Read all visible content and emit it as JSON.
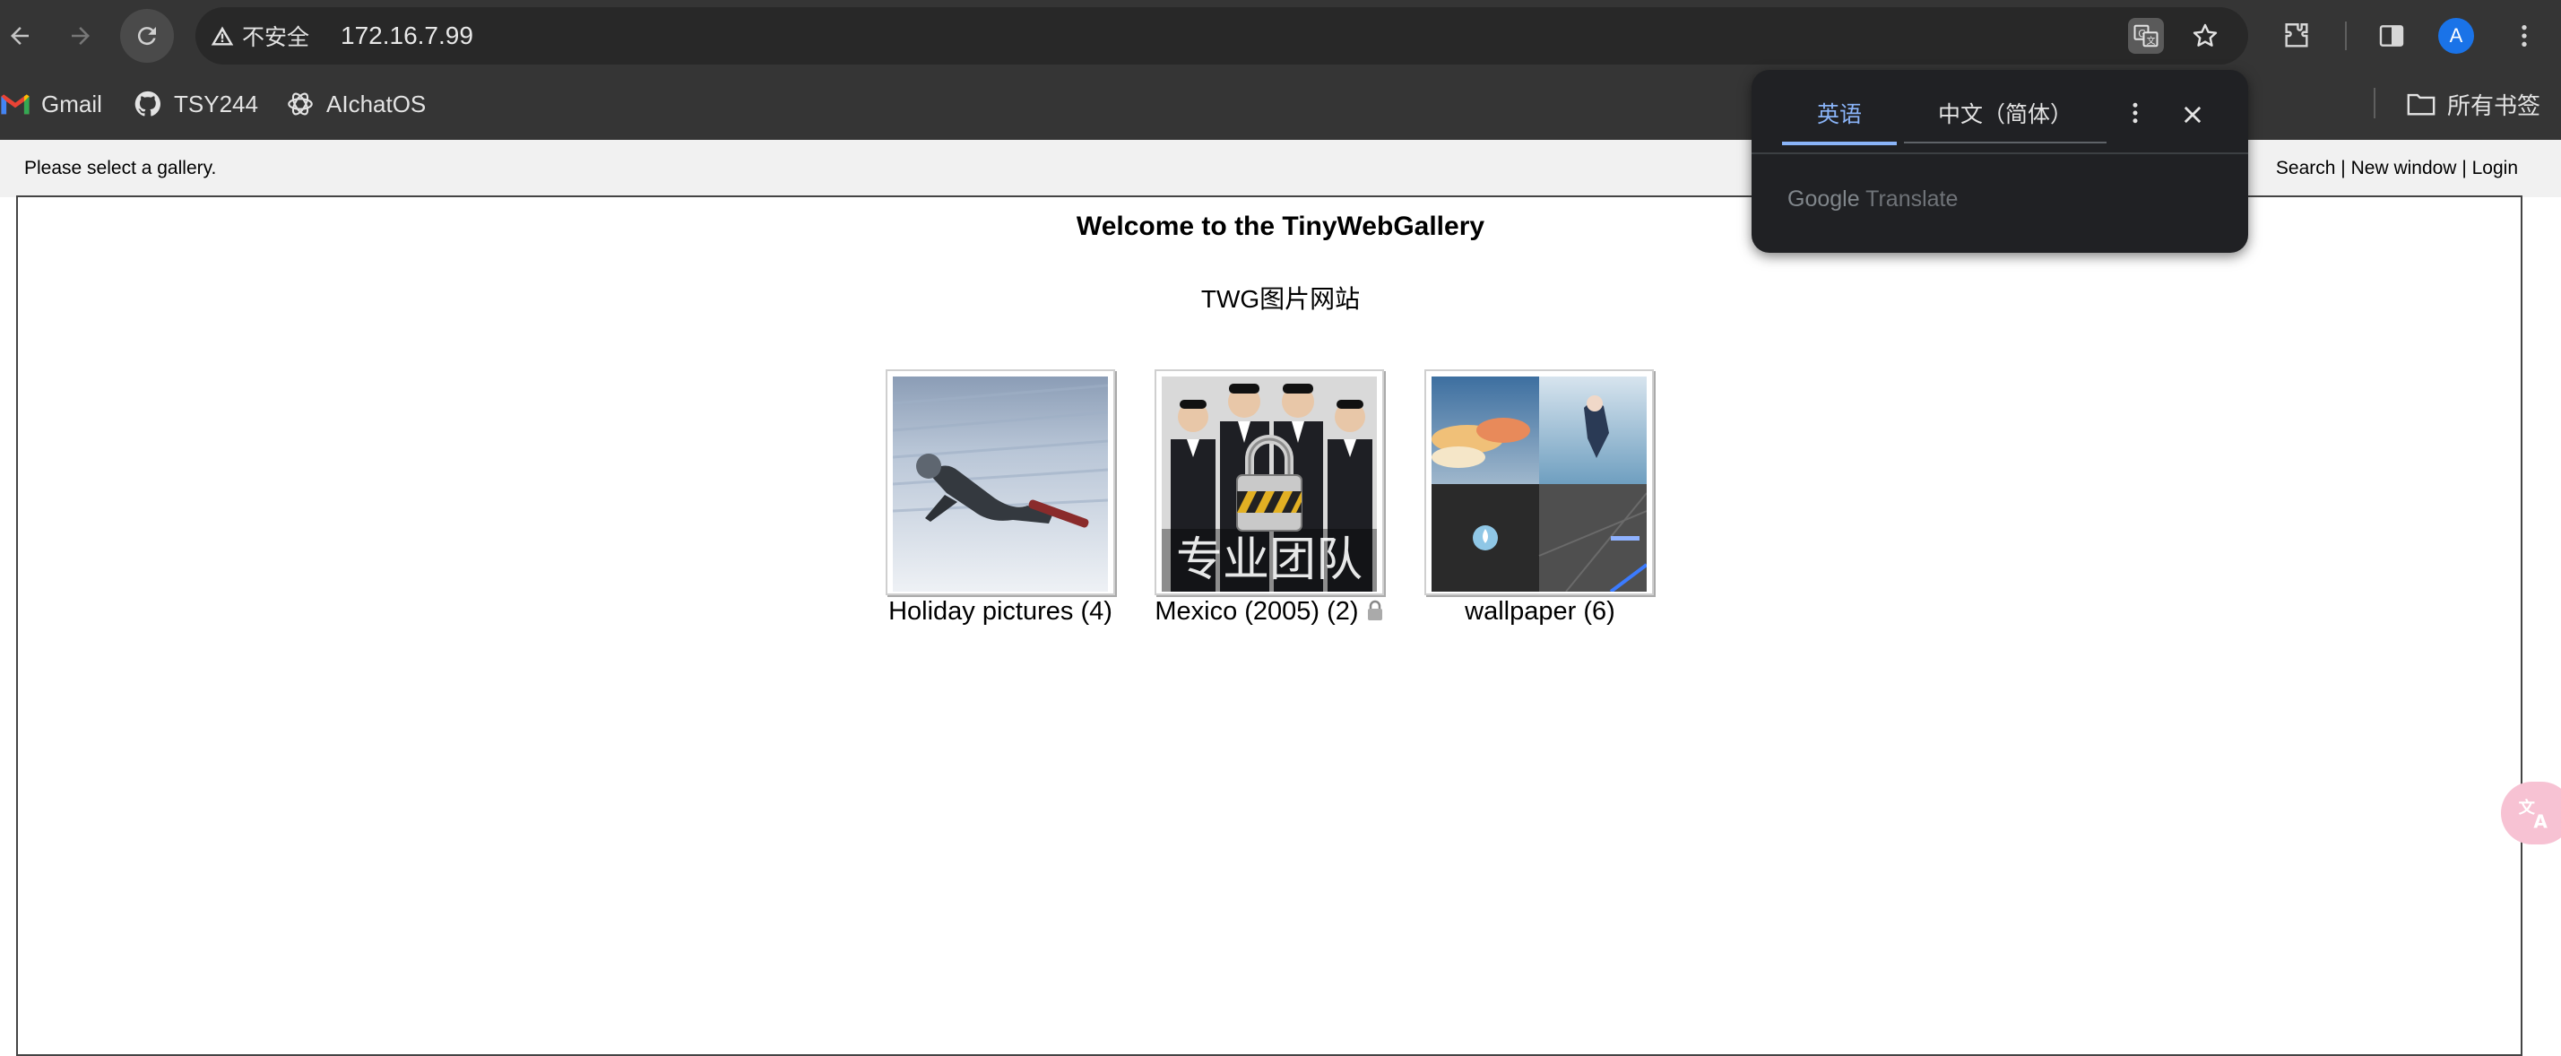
{
  "browser": {
    "security_label": "不安全",
    "url": "172.16.7.99",
    "avatar_letter": "A",
    "all_bookmarks_label": "所有书签"
  },
  "bookmarks": [
    {
      "label": "Gmail",
      "icon": "gmail-icon"
    },
    {
      "label": "TSY244",
      "icon": "github-icon"
    },
    {
      "label": "AIchatOS",
      "icon": "openai-icon"
    }
  ],
  "page": {
    "select_message": "Please select a gallery.",
    "top_links": [
      "Search",
      "New window",
      "Login"
    ],
    "link_separator": " | ",
    "welcome": "Welcome to the TinyWebGallery",
    "subtitle": "TWG图片网站",
    "galleries": [
      {
        "label": "Holiday pictures (4)",
        "locked": false
      },
      {
        "label": "Mexico (2005) (2)",
        "locked": true,
        "overlay_text": "专业团队"
      },
      {
        "label": "wallpaper (6)",
        "locked": false
      }
    ]
  },
  "translate_popup": {
    "source_tab": "英语",
    "target_tab": "中文（简体）",
    "brand_google": "Google",
    "brand_translate": "Translate"
  },
  "colors": {
    "chrome_bg": "#353535",
    "omnibox_bg": "#282828",
    "popup_bg": "#202124",
    "accent_blue": "#8ab4f8",
    "avatar_blue": "#1a73e8"
  }
}
